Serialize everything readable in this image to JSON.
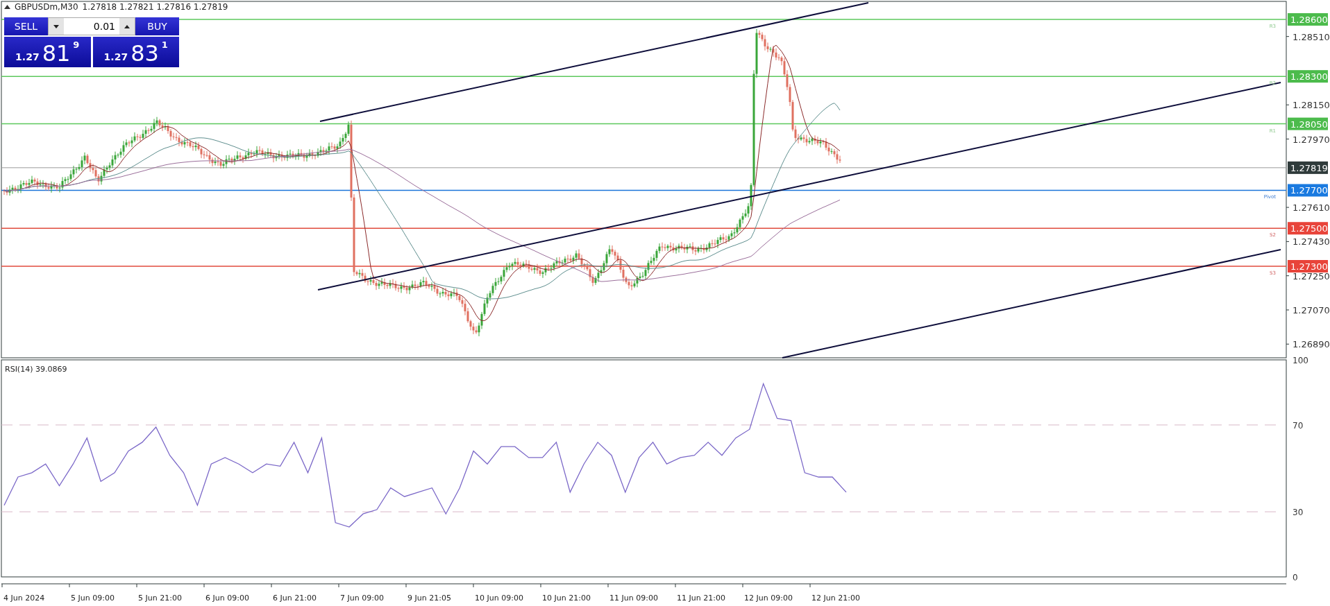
{
  "header": {
    "symbol": "GBPUSDm,M30",
    "quotes": "1.27818 1.27821 1.27816 1.27819"
  },
  "trade_panel": {
    "sell_label": "SELL",
    "buy_label": "BUY",
    "lot": "0.01",
    "sell_price": {
      "prefix": "1.27",
      "big": "81",
      "sup": "9"
    },
    "buy_price": {
      "prefix": "1.27",
      "big": "83",
      "sup": "1"
    }
  },
  "price_axis": {
    "ticks": [
      "1.28510",
      "1.28150",
      "1.27970",
      "1.27610",
      "1.27430",
      "1.27250",
      "1.27070",
      "1.26890"
    ]
  },
  "levels": [
    {
      "price": "1.28600",
      "tag": "R3",
      "kind": "resistance"
    },
    {
      "price": "1.28300",
      "tag": "R2",
      "kind": "resistance"
    },
    {
      "price": "1.28050",
      "tag": "R1",
      "kind": "resistance"
    },
    {
      "price": "1.27819",
      "kind": "current"
    },
    {
      "price": "1.27700",
      "tag": "Pivot",
      "kind": "pivot"
    },
    {
      "price": "1.27500",
      "tag": "S2",
      "kind": "support"
    },
    {
      "price": "1.27300",
      "tag": "S3",
      "kind": "support"
    }
  ],
  "rsi": {
    "value": "39.0869",
    "chart_data": {
      "type": "line",
      "ylim": [
        0,
        100
      ],
      "yticks": [
        0,
        30,
        70,
        100
      ],
      "series": [
        {
          "name": "RSI(14)",
          "color": "#7b68c8",
          "values": [
            33,
            46,
            48,
            52,
            42,
            52,
            64,
            44,
            48,
            58,
            62,
            69,
            56,
            48,
            33,
            52,
            55,
            52,
            48,
            52,
            51,
            62,
            48,
            64,
            25,
            23,
            29,
            31,
            41,
            37,
            39,
            41,
            29,
            41,
            58,
            52,
            60,
            60,
            55,
            55,
            62,
            39,
            52,
            62,
            56,
            39,
            55,
            62,
            52,
            55,
            56,
            62,
            56,
            64,
            68,
            89,
            73,
            72,
            48,
            46,
            46,
            39
          ]
        }
      ]
    }
  },
  "time_axis": {
    "labels": [
      "4 Jun 2024",
      "5 Jun 09:00",
      "5 Jun 21:00",
      "6 Jun 09:00",
      "6 Jun 21:00",
      "7 Jun 09:00",
      "9 Jun 21:05",
      "10 Jun 09:00",
      "10 Jun 21:00",
      "11 Jun 09:00",
      "11 Jun 21:00",
      "12 Jun 09:00",
      "12 Jun 21:00"
    ]
  }
}
